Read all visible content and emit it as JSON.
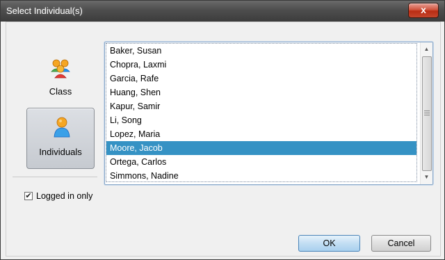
{
  "window": {
    "title": "Select Individual(s)",
    "close_label": "x"
  },
  "modes": {
    "class_label": "Class",
    "individuals_label": "Individuals",
    "selected": "Individuals"
  },
  "list": {
    "items": [
      "Baker, Susan",
      "Chopra, Laxmi",
      "Garcia, Rafe",
      "Huang, Shen",
      "Kapur, Samir",
      "Li, Song",
      "Lopez, Maria",
      "Moore, Jacob",
      "Ortega, Carlos",
      "Simmons, Nadine"
    ],
    "selected_item": "Moore, Jacob"
  },
  "options": {
    "logged_in_only_label": "Logged in only",
    "logged_in_only_checked": true
  },
  "buttons": {
    "ok_label": "OK",
    "cancel_label": "Cancel"
  },
  "colors": {
    "selection": "#3592c4",
    "titlebar": "#4d4d4d",
    "close_button": "#c4452c"
  }
}
